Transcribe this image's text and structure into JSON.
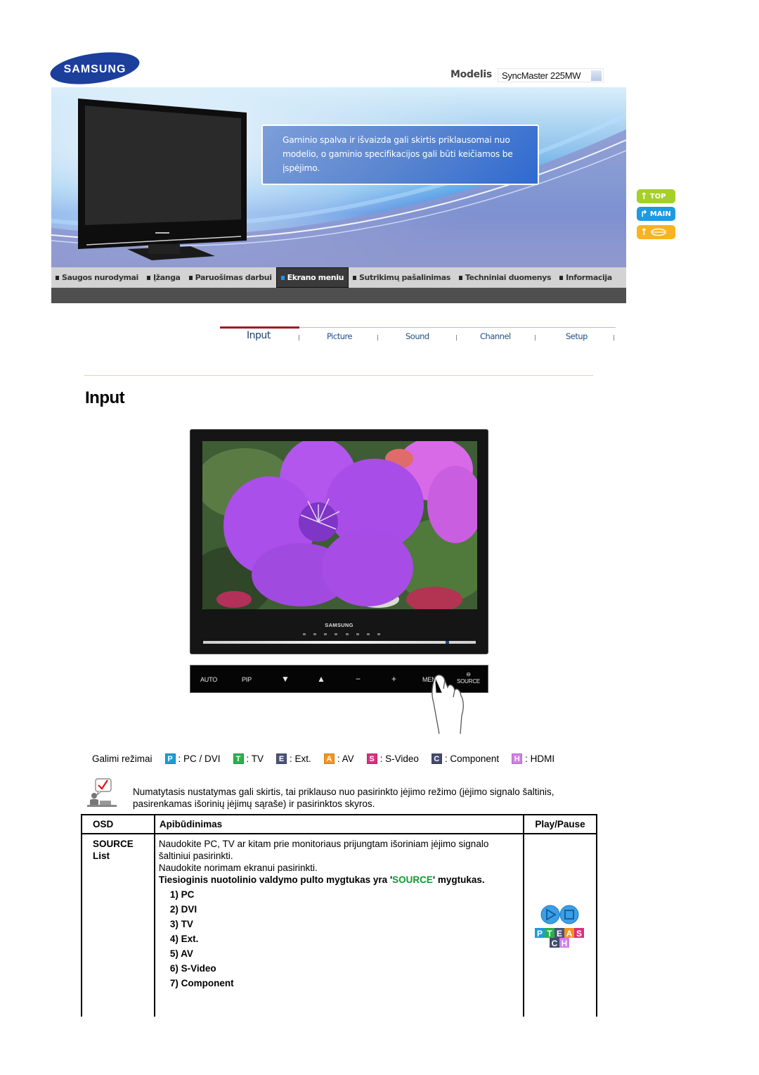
{
  "header": {
    "logo_text": "SAMSUNG",
    "model_label": "Modelis",
    "model_value": "SyncMaster 225MW"
  },
  "banner": {
    "notice": "Gaminio spalva ir išvaizda gali skirtis priklausomai nuo modelio, o gaminio specifikacijos gali būti keičiamos be įspėjimo."
  },
  "side_buttons": [
    {
      "label": "TOP",
      "icon": "arrow-up-icon",
      "color": "#a6cf2a"
    },
    {
      "label": "MAIN",
      "icon": "arrow-turn-up-icon",
      "color": "#1e9be0"
    },
    {
      "label": "",
      "icon": "print-icon",
      "color": "#f7b321"
    }
  ],
  "nav": {
    "items": [
      {
        "label": "Saugos nurodymai",
        "active": false
      },
      {
        "label": "Įžanga",
        "active": false
      },
      {
        "label": "Paruošimas darbui",
        "active": false
      },
      {
        "label": "Ekrano meniu",
        "active": true
      },
      {
        "label": "Sutrikimų pašalinimas",
        "active": false
      },
      {
        "label": "Techniniai duomenys",
        "active": false
      },
      {
        "label": "Informacija",
        "active": false
      }
    ]
  },
  "subtabs": {
    "items": [
      {
        "label": "Input",
        "active": true
      },
      {
        "label": "Picture",
        "active": false
      },
      {
        "label": "Sound",
        "active": false
      },
      {
        "label": "Channel",
        "active": false
      },
      {
        "label": "Setup",
        "active": false
      }
    ]
  },
  "page": {
    "title": "Input"
  },
  "monitor": {
    "brand": "SAMSUNG",
    "controls": [
      "AUTO",
      "PIP",
      "▼",
      "▲",
      "−",
      "+",
      "MENU",
      "SOURCE"
    ]
  },
  "modes": {
    "label": "Galimi režimai",
    "items": [
      {
        "badge": "P",
        "text": ": PC / DVI",
        "color": "#1e9bd7"
      },
      {
        "badge": "T",
        "text": ": TV",
        "color": "#2bb14a"
      },
      {
        "badge": "E",
        "text": ": Ext.",
        "color": "#4b5376"
      },
      {
        "badge": "A",
        "text": ": AV",
        "color": "#f7941d"
      },
      {
        "badge": "S",
        "text": ": S-Video",
        "color": "#d9307d"
      },
      {
        "badge": "C",
        "text": ": Component",
        "color": "#454a6c"
      },
      {
        "badge": "H",
        "text": ": HDMI",
        "color": "#d37ee8"
      }
    ]
  },
  "note": {
    "text": "Numatytasis nustatymas gali skirtis, tai priklauso nuo pasirinkto įėjimo režimo (įėjimo signalo šaltinis, pasirenkamas išorinių įėjimų sąraše) ir pasirinktos skyros."
  },
  "table": {
    "headers": {
      "osd": "OSD",
      "desc": "Apibūdinimas",
      "play": "Play/Pause"
    },
    "row": {
      "osd_line1": "SOURCE",
      "osd_line2": "List",
      "desc_line1": "Naudokite PC, TV ar kitam prie monitoriaus prijungtam išoriniam įėjimo signalo šaltiniui pasirinkti.",
      "desc_line2": "Naudokite norimam ekranui pasirinkti.",
      "bold_prefix": "Tiesioginis nuotolinio valdymo pulto mygtukas yra '",
      "bold_highlight": "SOURCE",
      "bold_suffix": "' mygtukas.",
      "highlight_color": "#0f9b2e",
      "list": [
        "1) PC",
        "2) DVI",
        "3) TV",
        "4) Ext.",
        "5) AV",
        "6) S-Video",
        "7) Component"
      ]
    },
    "play_icon_letters": [
      "P",
      "T",
      "E",
      "A",
      "S",
      "C",
      "H"
    ]
  }
}
